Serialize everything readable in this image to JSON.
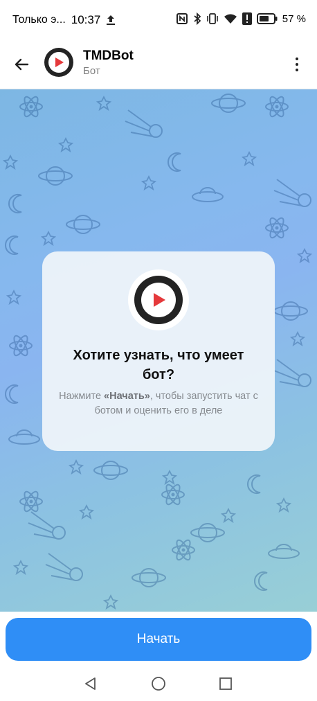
{
  "status_bar": {
    "carrier": "Только э...",
    "time": "10:37",
    "battery_percent": "57 %"
  },
  "header": {
    "title": "TMDBot",
    "subtitle": "Бот"
  },
  "intro": {
    "heading": "Хотите узнать, что умеет бот?",
    "desc_prefix": "Нажмите ",
    "desc_bold": "«Начать»",
    "desc_suffix": ", чтобы запустить чат с ботом и оценить его в деле"
  },
  "actions": {
    "start_label": "Начать"
  },
  "colors": {
    "accent": "#2f8ef6",
    "logo_red": "#e5393b",
    "logo_dark": "#232323"
  },
  "icons": [
    "back-arrow-icon",
    "more-vert-icon",
    "nfc-icon",
    "bluetooth-icon",
    "vibrate-icon",
    "wifi-icon",
    "battery-icon",
    "upload-icon"
  ]
}
